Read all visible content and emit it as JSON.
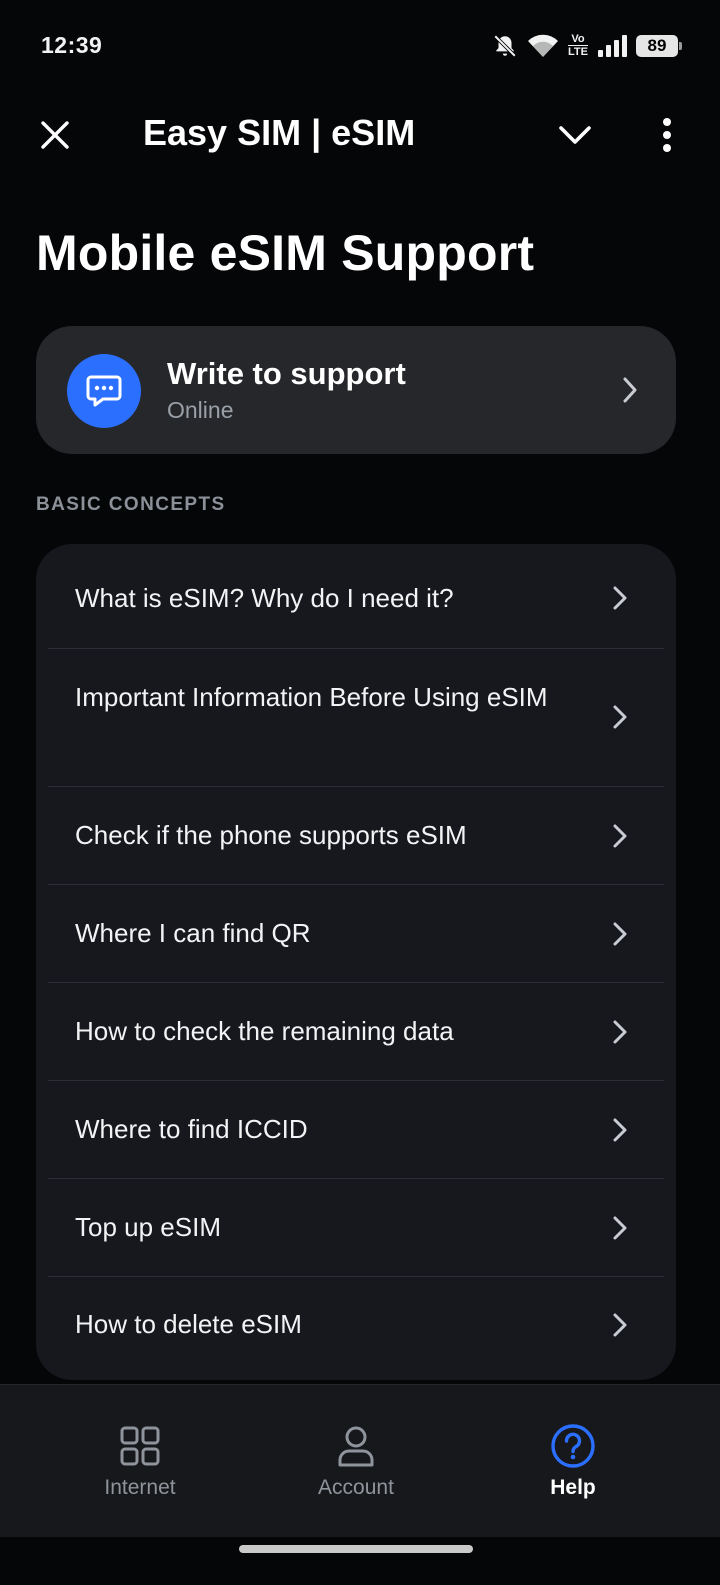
{
  "status_bar": {
    "time": "12:39",
    "volte_top": "Vo",
    "volte_bottom": "LTE",
    "battery": "89"
  },
  "header": {
    "title": "Easy SIM | eSIM"
  },
  "page": {
    "title": "Mobile eSIM Support"
  },
  "support": {
    "title": "Write to support",
    "status": "Online",
    "accent": "#2b6fff"
  },
  "section": {
    "heading": "BASIC CONCEPTS"
  },
  "faq": [
    {
      "label": "What is eSIM? Why do I need it?"
    },
    {
      "label": "Important Information Before Using eSIM"
    },
    {
      "label": "Check if the phone supports eSIM"
    },
    {
      "label": "Where I can find QR"
    },
    {
      "label": "How to check the remaining data"
    },
    {
      "label": "Where to find ICCID"
    },
    {
      "label": "Top up eSIM"
    },
    {
      "label": "How to delete eSIM"
    }
  ],
  "nav": {
    "items": [
      {
        "label": "Internet",
        "icon": "grid-icon"
      },
      {
        "label": "Account",
        "icon": "person-icon"
      },
      {
        "label": "Help",
        "icon": "help-icon"
      }
    ],
    "active": "Help",
    "active_color": "#2b6fff"
  }
}
